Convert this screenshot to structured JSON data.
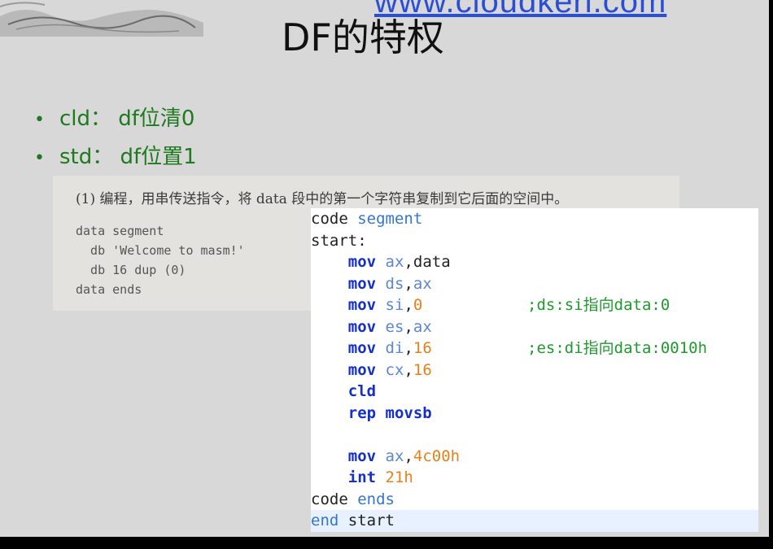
{
  "header": {
    "url": "www.cloudkeri.com",
    "title": "DF的特权"
  },
  "bullets": [
    {
      "label": "cld： df位清0"
    },
    {
      "label": "std： df位置1"
    }
  ],
  "book_excerpt": {
    "heading": "(1) 编程，用串传送指令，将 data 段中的第一个字符串复制到它后面的空间中。",
    "lines": [
      "data segment",
      "  db 'Welcome to masm!'",
      "  db 16 dup (0)",
      "data ends"
    ]
  },
  "code": {
    "l1": {
      "a": "code",
      "b": "segment"
    },
    "l2": {
      "a": "start:"
    },
    "l3": {
      "op": "mov",
      "r": "ax",
      "sep": ",",
      "v": "data"
    },
    "l4": {
      "op": "mov",
      "r": "ds",
      "sep": ",",
      "v": "ax"
    },
    "l5": {
      "op": "mov",
      "r": "si",
      "sep": ",",
      "v": "0",
      "comment": ";ds:si指向data:0"
    },
    "l6": {
      "op": "mov",
      "r": "es",
      "sep": ",",
      "v": "ax"
    },
    "l7": {
      "op": "mov",
      "r": "di",
      "sep": ",",
      "v": "16",
      "comment": ";es:di指向data:0010h"
    },
    "l8": {
      "op": "mov",
      "r": "cx",
      "sep": ",",
      "v": "16"
    },
    "l9": {
      "op": "cld"
    },
    "l10": {
      "op": "rep movsb"
    },
    "l11": {
      "op": "mov",
      "r": "ax",
      "sep": ",",
      "v": "4c00h"
    },
    "l12": {
      "op": "int",
      "v": "21h"
    },
    "l13": {
      "a": "code",
      "b": "ends"
    },
    "l14": {
      "a": "end",
      "b": "start"
    }
  }
}
